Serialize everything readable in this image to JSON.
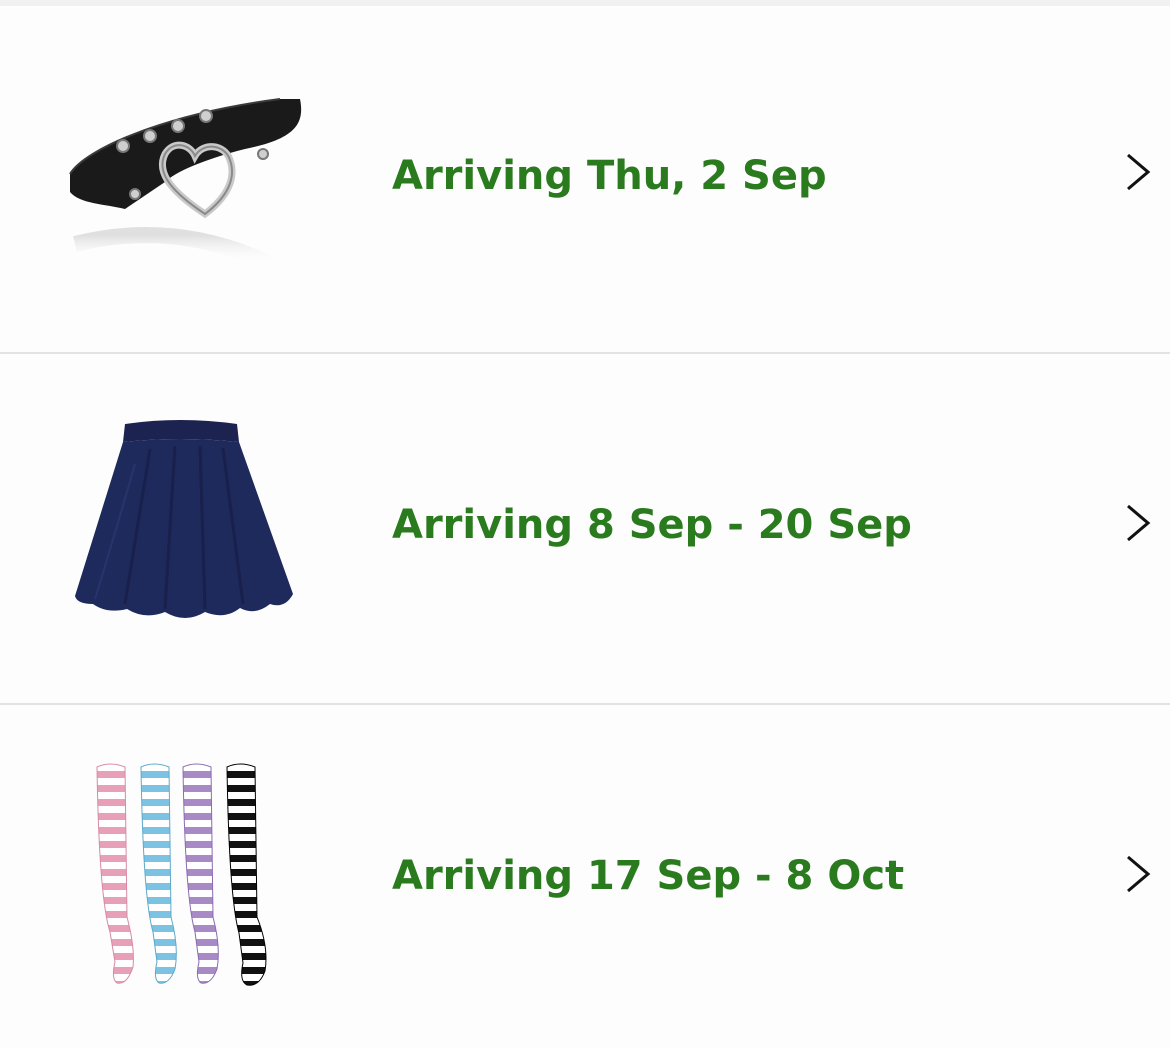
{
  "orders": [
    {
      "arrival_text": "Arriving Thu, 2 Sep",
      "product_icon": "choker-heart-necklace-image",
      "chevron_icon": "chevron-right-icon"
    },
    {
      "arrival_text": "Arriving 8 Sep - 20 Sep",
      "product_icon": "navy-skater-skirt-image",
      "chevron_icon": "chevron-right-icon"
    },
    {
      "arrival_text": "Arriving 17 Sep - 8 Oct",
      "product_icon": "striped-thigh-high-socks-image",
      "chevron_icon": "chevron-right-icon"
    }
  ],
  "colors": {
    "arrival_green": "#2a7a1e",
    "divider": "#e3e3e3",
    "chevron": "#111111"
  }
}
